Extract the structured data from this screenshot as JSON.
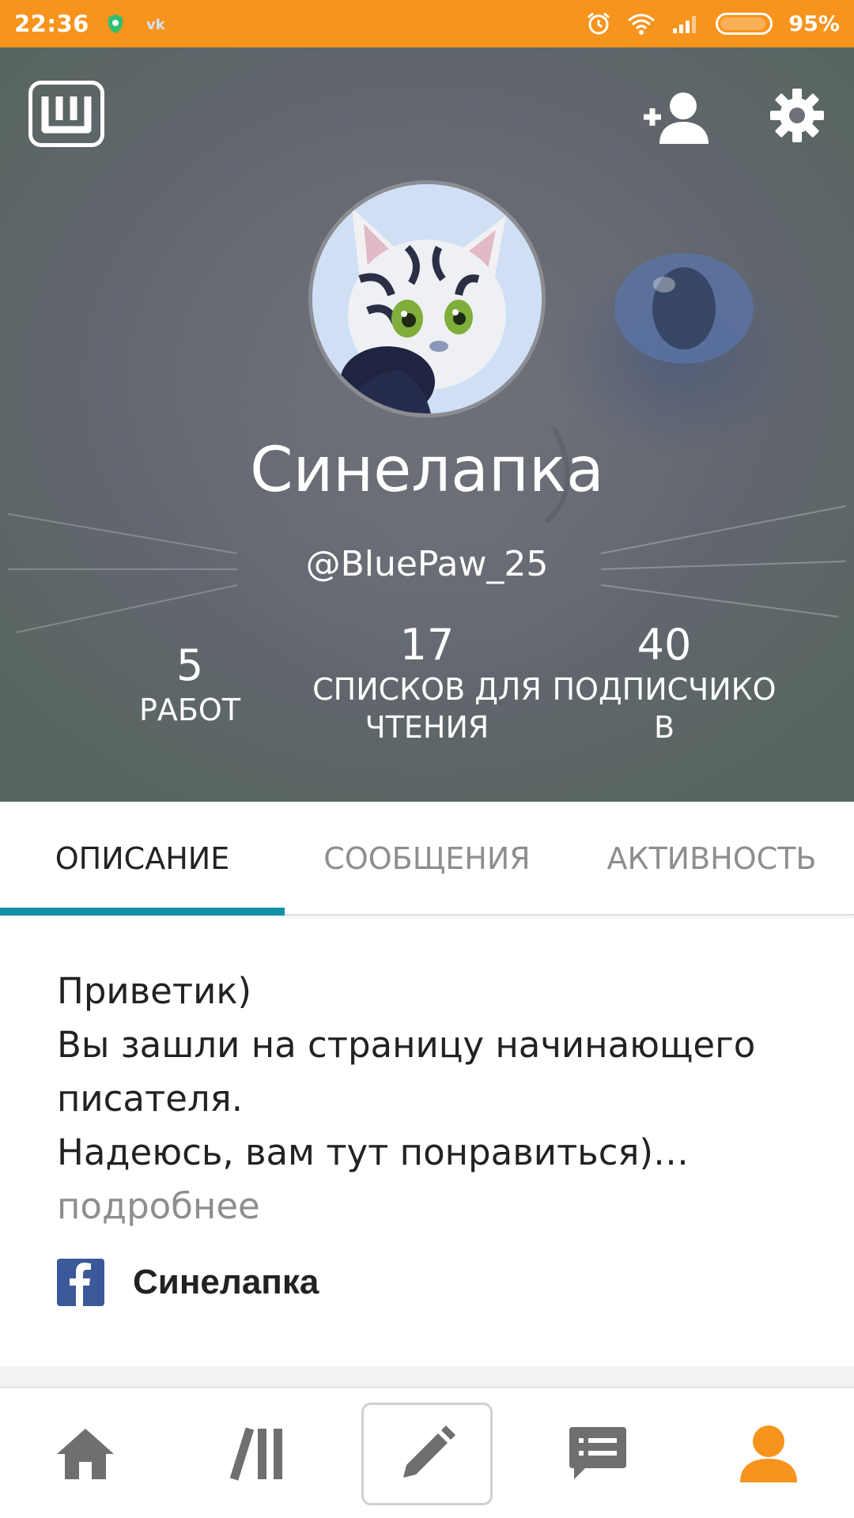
{
  "status_bar": {
    "time": "22:36",
    "battery_percent": "95%",
    "battery_level": 0.95,
    "left_icons": [
      "shield-icon",
      "vk-icon"
    ],
    "right_icons": [
      "alarm-icon",
      "wifi-icon",
      "signal-icon",
      "battery-icon"
    ],
    "color": "#f7941d"
  },
  "header": {
    "logo_icon": "wattpad-logo-icon",
    "actions": [
      "add-friend-icon",
      "gear-icon"
    ],
    "display_name": "Синелапка",
    "username": "@BluePaw_25",
    "stats": [
      {
        "value": "5",
        "label_lines": [
          "РАБОТ"
        ]
      },
      {
        "value": "17",
        "label_lines": [
          "СПИСКОВ ДЛЯ",
          "ЧТЕНИЯ"
        ]
      },
      {
        "value": "40",
        "label_lines": [
          "ПОДПИСЧИКО",
          "В"
        ]
      }
    ]
  },
  "tabs": {
    "items": [
      {
        "label": "ОПИСАНИЕ",
        "active": true
      },
      {
        "label": "СООБЩЕНИЯ",
        "active": false
      },
      {
        "label": "АКТИВНОСТЬ",
        "active": false
      }
    ],
    "indicator_color": "#1192a9"
  },
  "about": {
    "lines": [
      "Приветик)",
      "Вы зашли на страницу начинающего",
      "писателя.",
      "Надеюсь, вам тут понравиться)…"
    ],
    "more_link": "подробнее",
    "facebook_name": "Синелапка"
  },
  "bottom_nav": {
    "items": [
      {
        "icon": "home-icon",
        "active": false
      },
      {
        "icon": "library-icon",
        "active": false
      },
      {
        "icon": "pencil-icon",
        "active": false
      },
      {
        "icon": "messages-icon",
        "active": false
      },
      {
        "icon": "profile-icon",
        "active": true
      }
    ],
    "active_color": "#f7941d",
    "inactive_color": "#6f6f6f"
  }
}
